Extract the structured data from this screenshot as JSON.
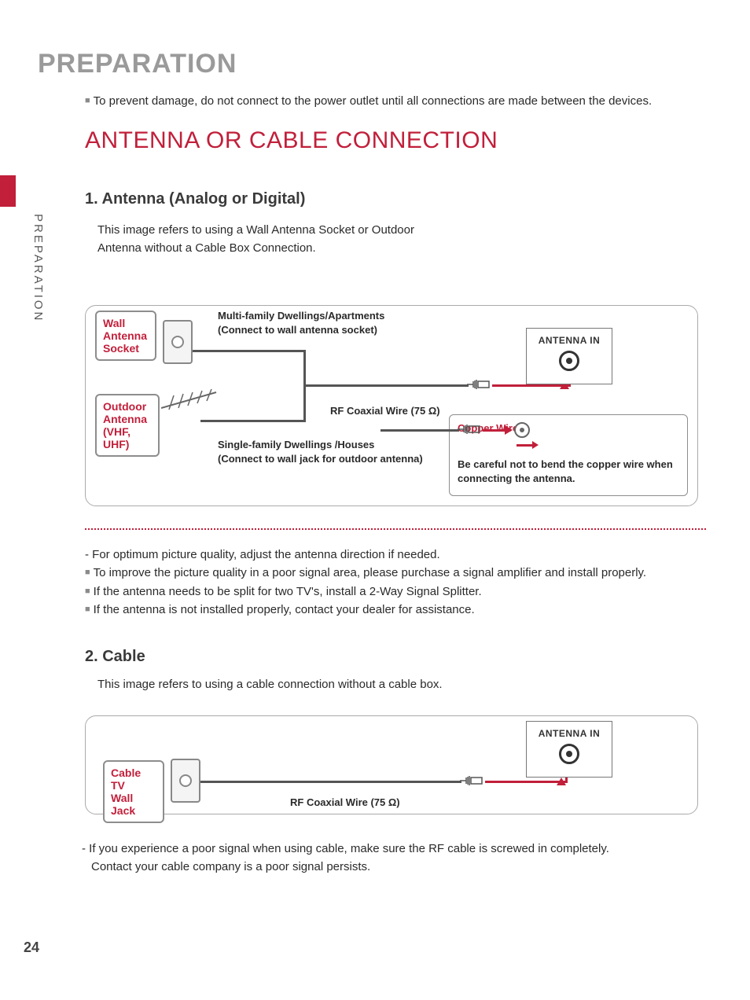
{
  "page_title": "PREPARATION",
  "side_label": "PREPARATION",
  "warning": "To prevent damage, do not connect to the power outlet until all connections are made between the devices.",
  "section_title": "ANTENNA OR CABLE CONNECTION",
  "sub1": "1. Antenna (Analog or Digital)",
  "desc1_a": "This image refers to using a Wall Antenna Socket or Outdoor",
  "desc1_b": "Antenna without a Cable Box Connection.",
  "diagram1": {
    "wall_antenna_socket": "Wall\nAntenna\nSocket",
    "outdoor_antenna": "Outdoor\nAntenna\n(VHF, UHF)",
    "multi_family": "Multi-family Dwellings/Apartments\n(Connect to wall antenna socket)",
    "single_family": "Single-family Dwellings /Houses\n(Connect to wall jack for outdoor antenna)",
    "rf_coaxial": "RF Coaxial Wire (75 Ω)",
    "antenna_in": "ANTENNA IN",
    "copper_wire": "Copper Wire",
    "copper_note": "Be careful not to bend the copper wire when connecting the antenna."
  },
  "notes_dash": "- For optimum picture quality, adjust the antenna direction if needed.",
  "notes_b1": "To improve the picture quality in a poor signal area, please purchase a signal amplifier and install properly.",
  "notes_b2": "If the antenna needs to be split for two TV's, install a 2-Way Signal Splitter.",
  "notes_b3": "If the antenna is not installed properly, contact your dealer for assistance.",
  "sub2": "2. Cable",
  "desc2": "This image refers to using a cable connection without a cable box.",
  "diagram2": {
    "cable_tv_wall_jack": "Cable TV\nWall Jack",
    "rf_coaxial": "RF Coaxial Wire (75 Ω)",
    "antenna_in": "ANTENNA IN"
  },
  "notes2_a": "- If you experience a poor signal when using cable, make sure the RF cable is screwed in completely.",
  "notes2_b": "Contact your cable company is a poor signal persists.",
  "page_number": "24"
}
